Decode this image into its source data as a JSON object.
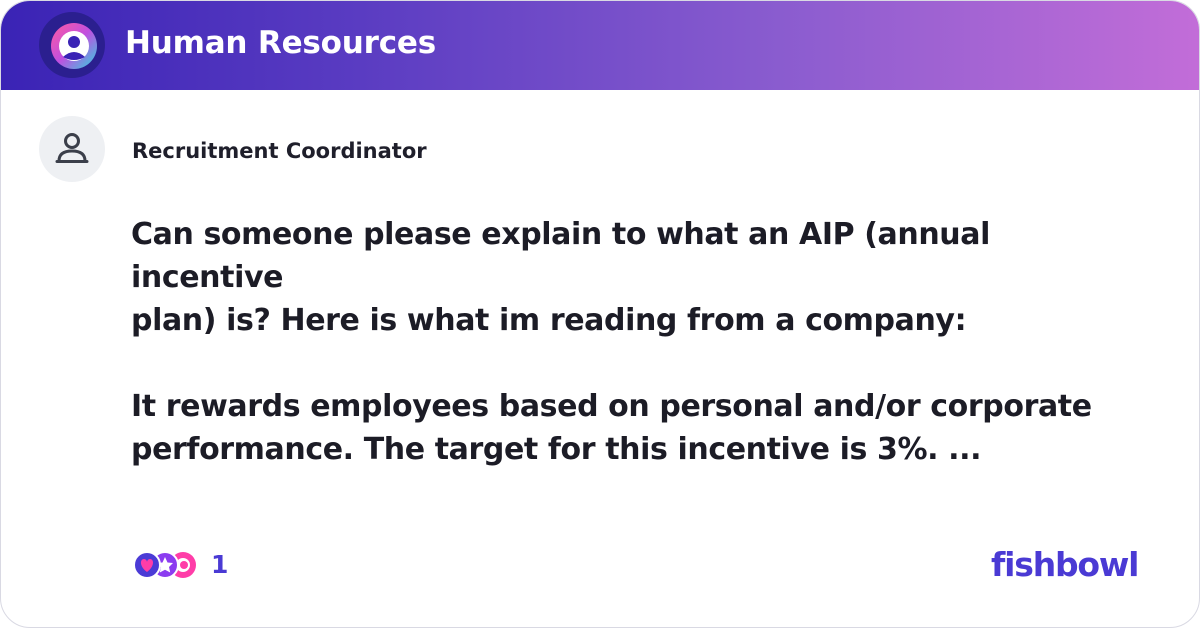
{
  "header": {
    "title": "Human Resources",
    "logo_icon": "fishbowl-bowl-icon"
  },
  "post": {
    "author": "Recruitment Coordinator",
    "avatar_icon": "person-icon",
    "line_1": "Can someone please explain to what an AIP (annual incentive",
    "line_2": "plan) is? Here is what im reading from a company:",
    "line_3": "It rewards employees based on personal and/or corporate",
    "line_4": "performance. The target for this incentive is 3%. ..."
  },
  "footer": {
    "reaction_icons": [
      "heart-reaction-icon",
      "star-reaction-icon",
      "bulb-reaction-icon"
    ],
    "reaction_count": "1",
    "brand": "fishbowl"
  },
  "colors": {
    "header_gradient_start": "#3a23b5",
    "header_gradient_end": "#c26dd8",
    "accent": "#4a3ad4",
    "text": "#1c1c26"
  }
}
